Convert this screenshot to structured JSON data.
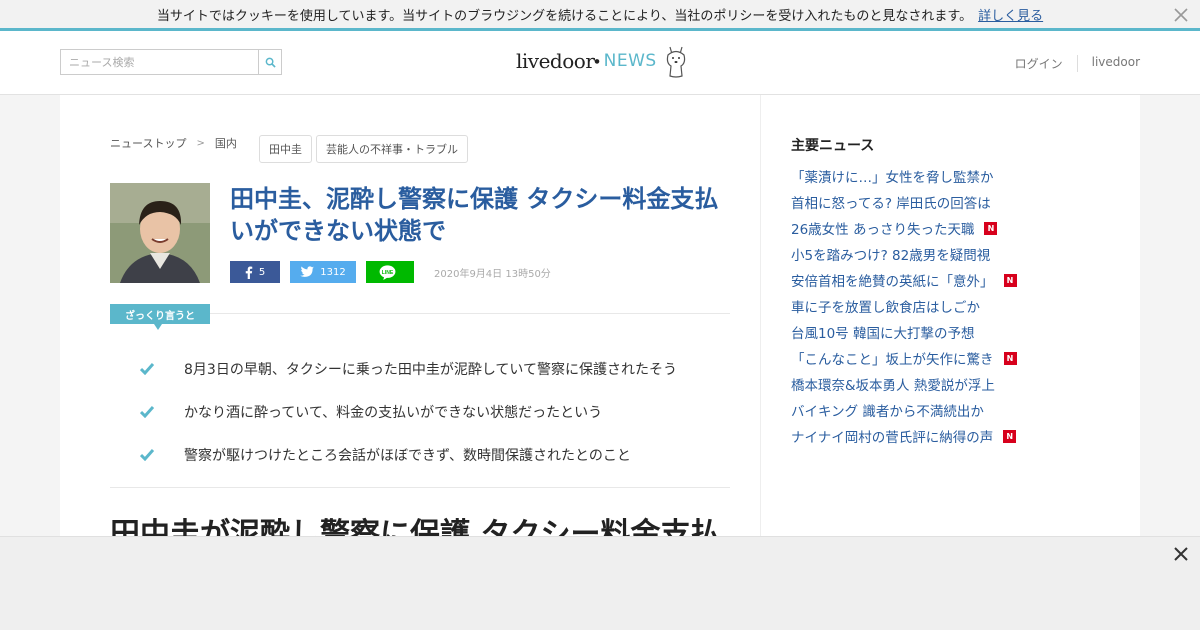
{
  "cookie": {
    "message": "当サイトではクッキーを使用しています。当サイトのブラウジングを続けることにより、当社のポリシーを受け入れたものと見なされます。",
    "link": "詳しく見る"
  },
  "header": {
    "search_placeholder": "ニュース検索",
    "logo_main": "livedoor",
    "logo_news": "NEWS",
    "nav": [
      "ログイン",
      "livedoor"
    ]
  },
  "breadcrumb": [
    "ニューストップ",
    "国内"
  ],
  "tags": [
    "田中圭",
    "芸能人の不祥事・トラブル"
  ],
  "article": {
    "title": "田中圭、泥酔し警察に保護 タクシー料金支払いができない状態で",
    "fb_count": "5",
    "tw_count": "1312",
    "date": "2020年9月4日 13時50分",
    "summary_label": "ざっくり言うと",
    "points": [
      "8月3日の早朝、タクシーに乗った田中圭が泥酔していて警察に保護されたそう",
      "かなり酒に酔っていて、料金の支払いができない状態だったという",
      "警察が駆けつけたところ会話がほぼできず、数時間保護されたとのこと"
    ],
    "body_heading": "田中圭が泥酔し警察に保護 タクシー料金支払"
  },
  "sidebar": {
    "title": "主要ニュース",
    "items": [
      {
        "text": "「薬漬けに…」女性を脅し監禁か",
        "new": false
      },
      {
        "text": "首相に怒ってる? 岸田氏の回答は",
        "new": false
      },
      {
        "text": "26歳女性 あっさり失った天職",
        "new": true
      },
      {
        "text": "小5を踏みつけ? 82歳男を疑問視",
        "new": false
      },
      {
        "text": "安倍首相を絶賛の英紙に「意外」",
        "new": true
      },
      {
        "text": "車に子を放置し飲食店はしごか",
        "new": false
      },
      {
        "text": "台風10号 韓国に大打撃の予想",
        "new": false
      },
      {
        "text": "「こんなこと」坂上が矢作に驚き",
        "new": true
      },
      {
        "text": "橋本環奈&坂本勇人 熱愛説が浮上",
        "new": false
      },
      {
        "text": "バイキング 識者から不満続出か",
        "new": false
      },
      {
        "text": "ナイナイ岡村の菅氏評に納得の声",
        "new": true
      }
    ],
    "badge": "N"
  },
  "colors": {
    "accent": "#5bb7cb",
    "link": "#2a5d9f",
    "facebook": "#3b5998",
    "twitter": "#55acee",
    "line": "#00b900",
    "new_badge": "#d7001c"
  }
}
